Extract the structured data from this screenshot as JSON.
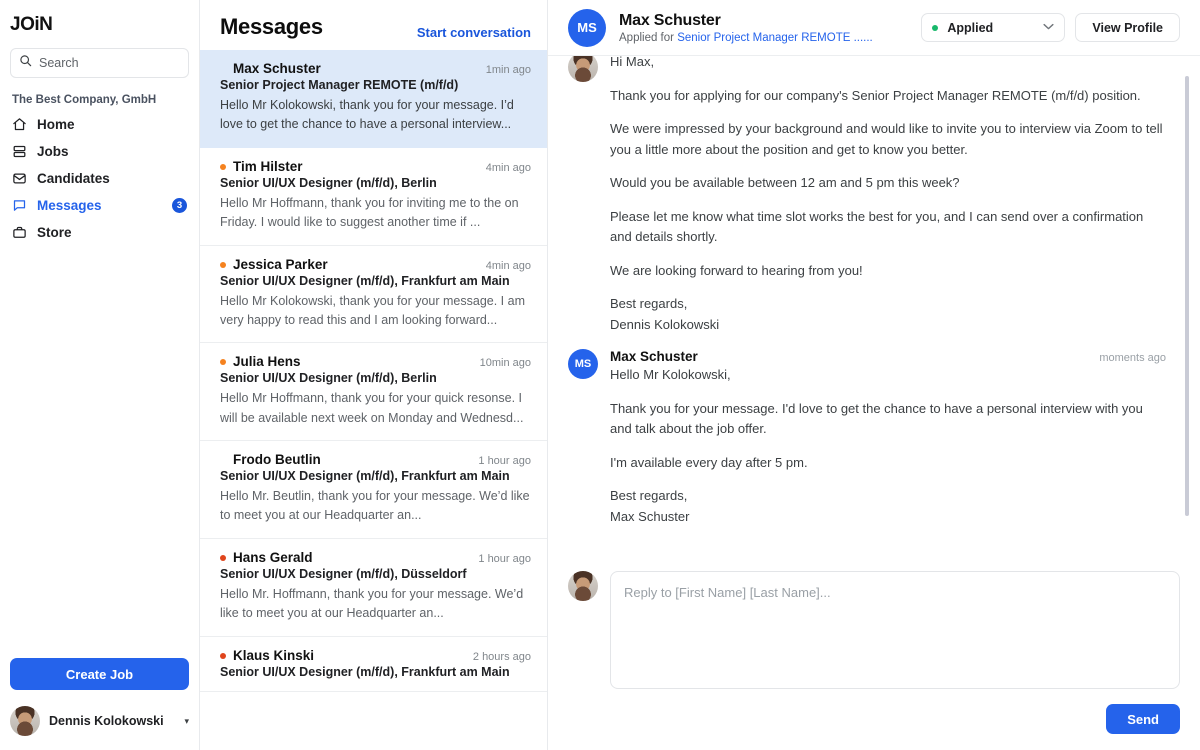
{
  "sidebar": {
    "logo": "JOiN",
    "search": {
      "placeholder": "Search",
      "value": "",
      "icon": "search-icon"
    },
    "company_label": "The Best Company, GmbH",
    "items": [
      {
        "label": "Home",
        "icon": "home-icon",
        "active": false,
        "badge": ""
      },
      {
        "label": "Jobs",
        "icon": "jobs-icon",
        "active": false,
        "badge": ""
      },
      {
        "label": "Candidates",
        "icon": "candidates-icon",
        "active": false,
        "badge": ""
      },
      {
        "label": "Messages",
        "icon": "messages-icon",
        "active": true,
        "badge": "3"
      },
      {
        "label": "Store",
        "icon": "store-icon",
        "active": false,
        "badge": ""
      }
    ],
    "create_job_label": "Create Job",
    "user_name": "Dennis Kolokowski",
    "user_caret": "▾",
    "accent_color": "#2563eb",
    "badge_color": "#1a56db"
  },
  "conversations": {
    "title": "Messages",
    "start_conversation_label": "Start conversation",
    "items": [
      {
        "name": "Max Schuster",
        "role": "Senior Project Manager REMOTE (m/f/d)",
        "preview": "Hello Mr Kolokowski, thank you for your message. I’d love to get the chance to have a personal interview...",
        "time": "1min ago",
        "selected": true,
        "unread": false,
        "dot_color": ""
      },
      {
        "name": "Tim Hilster",
        "role": "Senior UI/UX Designer (m/f/d), Berlin",
        "preview": "Hello Mr Hoffmann, thank you for inviting me to the on Friday. I would like to suggest another time if ...",
        "time": "4min ago",
        "selected": false,
        "unread": true,
        "dot_color": "#f5821f"
      },
      {
        "name": "Jessica Parker",
        "role": "Senior UI/UX Designer (m/f/d), Frankfurt am Main",
        "preview": "Hello Mr Kolokowski, thank you for your message. I am very happy to read this and I am looking forward...",
        "time": "4min ago",
        "selected": false,
        "unread": true,
        "dot_color": "#f5821f"
      },
      {
        "name": "Julia Hens",
        "role": "Senior UI/UX Designer (m/f/d), Berlin",
        "preview": "Hello Mr Hoffmann, thank you for your quick resonse. I will be available next week on Monday and Wednesd...",
        "time": "10min ago",
        "selected": false,
        "unread": true,
        "dot_color": "#f5821f"
      },
      {
        "name": "Frodo Beutlin",
        "role": "Senior UI/UX Designer (m/f/d), Frankfurt am Main",
        "preview": "Hello Mr. Beutlin, thank you for your message. We’d like to meet you at our Headquarter an...",
        "time": "1 hour ago",
        "selected": false,
        "unread": false,
        "dot_color": ""
      },
      {
        "name": "Hans Gerald",
        "role": "Senior UI/UX Designer (m/f/d), Düsseldorf",
        "preview": "Hello Mr. Hoffmann, thank you for your message. We’d like to meet you at our Headquarter an...",
        "time": "1 hour ago",
        "selected": false,
        "unread": true,
        "dot_color": "#e0451c"
      },
      {
        "name": "Klaus Kinski",
        "role": "Senior UI/UX Designer (m/f/d), Frankfurt am Main",
        "preview": "",
        "time": "2 hours ago",
        "selected": false,
        "unread": true,
        "dot_color": "#e0451c"
      }
    ]
  },
  "thread": {
    "header": {
      "avatar_initials": "MS",
      "name": "Max Schuster",
      "applied_prefix": "Applied for",
      "job_link": "Senior Project Manager REMOTE ......",
      "status_label": "Applied",
      "status_dot_color": "#18b86b",
      "status_chevron": "⌄",
      "view_profile_label": "View Profile"
    },
    "messages": [
      {
        "sender": "Dennis Kolokowski",
        "time": "",
        "avatar_type": "photo",
        "avatar_initials": "",
        "show_meta": false,
        "paragraphs": [
          "Hi Max,",
          "Thank you for applying for our company's Senior Project Manager REMOTE (m/f/d) position.",
          "We were impressed by your background and would like to invite you to interview via Zoom to tell you a little more about the position and get to know you better.",
          "Would you be available between 12 am and 5 pm this week?",
          "Please let me know what time slot works the best for you, and I can send over a confirmation and details shortly.",
          "We are looking forward to hearing from you!",
          "Best regards,",
          "Dennis Kolokowski"
        ]
      },
      {
        "sender": "Max Schuster",
        "time": "moments ago",
        "avatar_type": "initials",
        "avatar_initials": "MS",
        "show_meta": true,
        "paragraphs": [
          "Hello Mr Kolokowski,",
          "Thank you for your message. I'd love to get the chance to have a personal interview with you and talk about the job offer.",
          "I'm available every day after 5 pm.",
          "Best regards,",
          "Max Schuster"
        ]
      }
    ]
  },
  "composer": {
    "placeholder": "Reply to [First Name] [Last Name]...",
    "value": "",
    "send_label": "Send"
  }
}
